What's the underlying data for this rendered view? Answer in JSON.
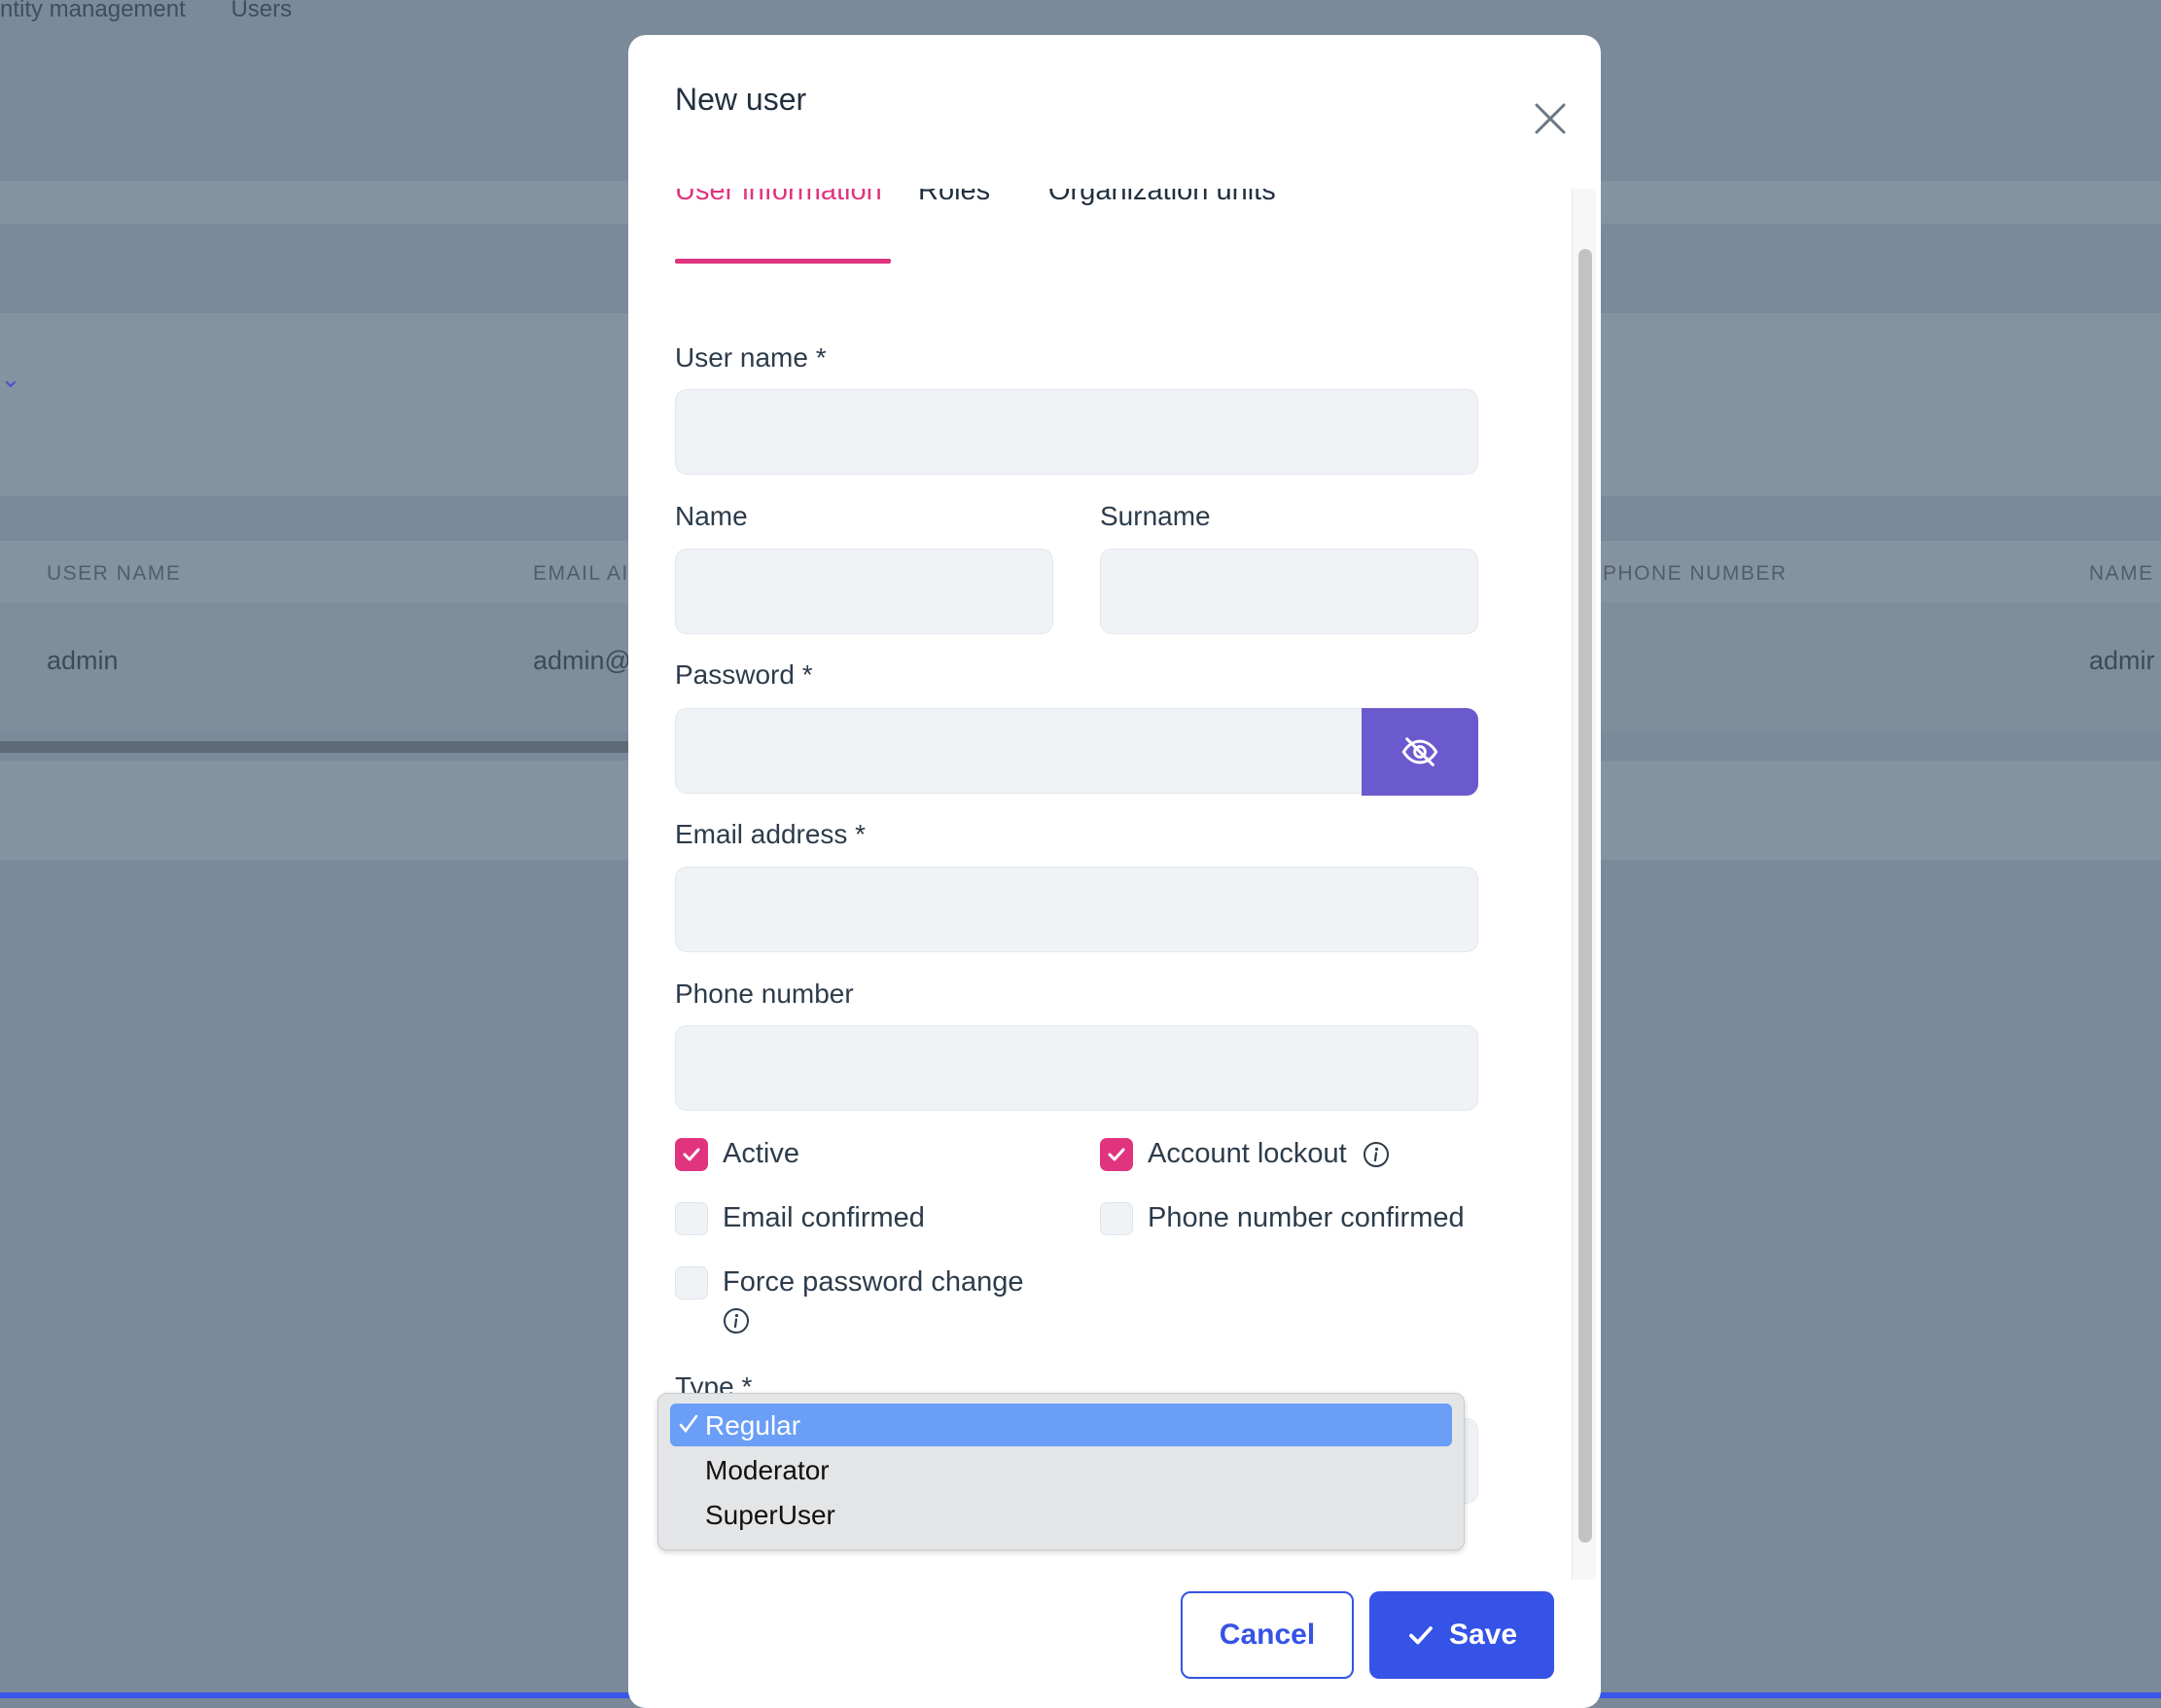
{
  "background": {
    "breadcrumb": [
      "ntity management",
      "Users"
    ],
    "table_headers": [
      "USER NAME",
      "EMAIL AI",
      "PHONE NUMBER",
      "NAME"
    ],
    "row": {
      "user_name": "admin",
      "email": "admin@",
      "name": "admir"
    }
  },
  "modal": {
    "title": "New user",
    "tabs": [
      {
        "label": "User information",
        "active": true
      },
      {
        "label": "Roles",
        "active": false
      },
      {
        "label": "Organization units",
        "active": false
      }
    ],
    "fields": {
      "user_name": {
        "label": "User name *",
        "value": ""
      },
      "name": {
        "label": "Name",
        "value": ""
      },
      "surname": {
        "label": "Surname",
        "value": ""
      },
      "password": {
        "label": "Password *",
        "value": ""
      },
      "email": {
        "label": "Email address *",
        "value": ""
      },
      "phone": {
        "label": "Phone number",
        "value": ""
      }
    },
    "checkboxes": [
      {
        "label": "Active",
        "checked": true
      },
      {
        "label": "Account lockout",
        "checked": true
      },
      {
        "label": "Email confirmed",
        "checked": false
      },
      {
        "label": "Phone number confirmed",
        "checked": false
      },
      {
        "label": "Force password change",
        "checked": false
      }
    ],
    "type": {
      "label": "Type *",
      "options": [
        "Regular",
        "Moderator",
        "SuperUser"
      ],
      "selected": "Regular"
    },
    "buttons": {
      "cancel": "Cancel",
      "save": "Save"
    }
  },
  "colors": {
    "accent": "#e0357e",
    "primary": "#3553e6",
    "eye_button": "#6a5acd"
  },
  "icons": [
    "close-icon",
    "eye-off-icon",
    "check-icon",
    "info-icon",
    "chevron-down-icon"
  ]
}
